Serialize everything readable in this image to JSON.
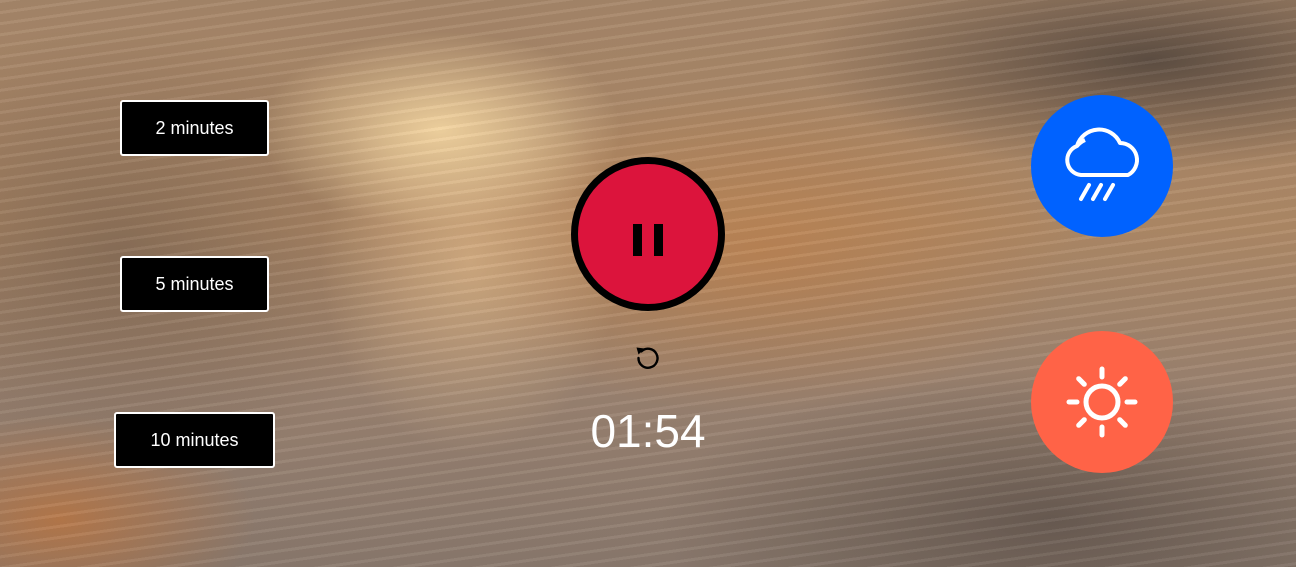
{
  "durations": {
    "two": "2 minutes",
    "five": "5 minutes",
    "ten": "10 minutes"
  },
  "player": {
    "state": "playing",
    "play_pause_icon": "pause-icon",
    "reset_icon": "reset-icon"
  },
  "timer": {
    "display": "01:54"
  },
  "sounds": {
    "rain": {
      "icon": "cloud-rain-icon",
      "color": "#0062ff"
    },
    "sun": {
      "icon": "sun-icon",
      "color": "#ff6347"
    }
  },
  "colors": {
    "pause_button": "#dc143c",
    "duration_button_bg": "#000000",
    "text": "#ffffff"
  }
}
